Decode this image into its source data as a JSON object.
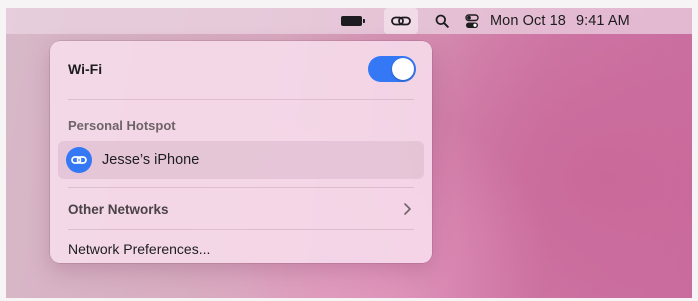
{
  "menubar": {
    "battery_icon": "battery-icon",
    "hotspot_icon": "personal-hotspot-link-icon",
    "search_icon": "search-icon",
    "control_center_icon": "control-center-icon",
    "date": "Mon Oct 18",
    "time": "9:41 AM"
  },
  "panel": {
    "wifi": {
      "label": "Wi-Fi",
      "toggle_on": true,
      "accent_color": "#3478f6"
    },
    "personal_hotspot": {
      "header": "Personal Hotspot",
      "device": {
        "name": "Jesse’s iPhone",
        "icon": "link-icon"
      }
    },
    "other_networks": {
      "label": "Other Networks",
      "icon": "chevron-right-icon"
    },
    "network_preferences": {
      "label": "Network Preferences..."
    }
  }
}
